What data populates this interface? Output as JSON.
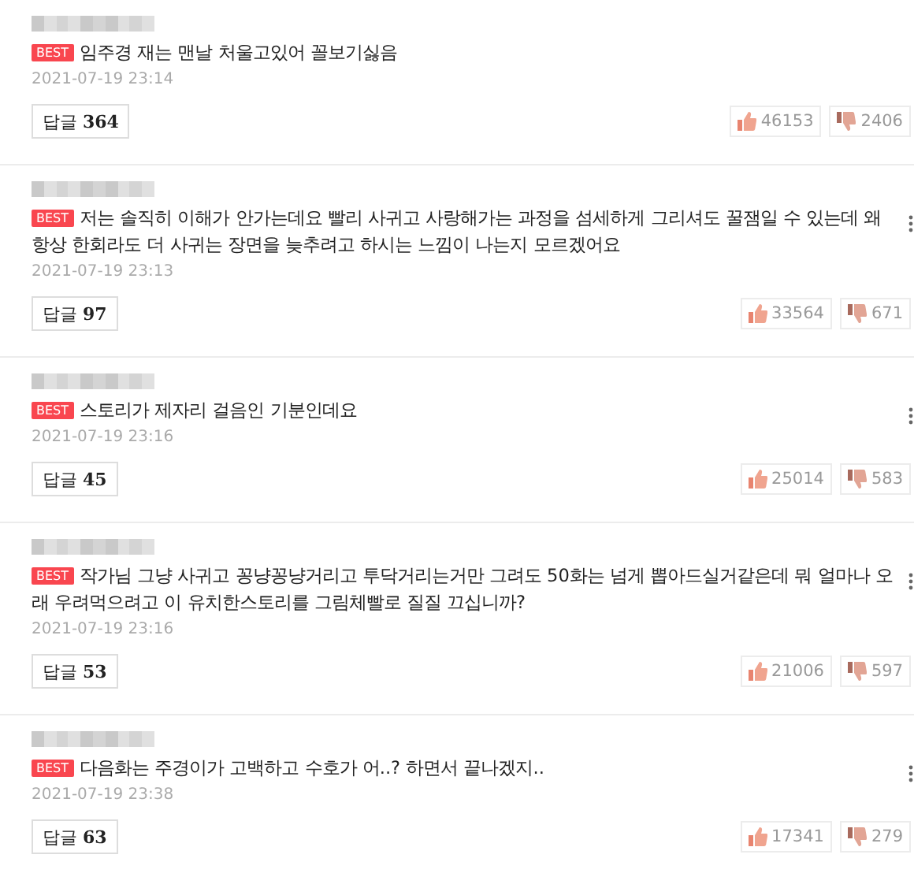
{
  "comments": [
    {
      "best": true,
      "badge": "BEST",
      "text": "임주경 재는 맨날 처울고있어 꼴보기싫음",
      "date": "2021-07-19 23:14",
      "reply_label": "답글",
      "reply_count": "364",
      "likes": "46153",
      "dislikes": "2406",
      "more_icon": false
    },
    {
      "best": true,
      "badge": "BEST",
      "text": "저는 솔직히 이해가 안가는데요 빨리 사귀고 사랑해가는 과정을 섬세하게 그리셔도 꿀잼일 수 있는데 왜 항상 한회라도 더 사귀는 장면을 늦추려고 하시는 느낌이 나는지 모르겠어요",
      "date": "2021-07-19 23:13",
      "reply_label": "답글",
      "reply_count": "97",
      "likes": "33564",
      "dislikes": "671",
      "more_icon": true
    },
    {
      "best": true,
      "badge": "BEST",
      "text": "스토리가 제자리 걸음인 기분인데요",
      "date": "2021-07-19 23:16",
      "reply_label": "답글",
      "reply_count": "45",
      "likes": "25014",
      "dislikes": "583",
      "more_icon": true
    },
    {
      "best": true,
      "badge": "BEST",
      "text": "작가님 그냥 사귀고 꽁냥꽁냥거리고 투닥거리는거만 그려도 50화는 넘게 뽑아드실거같은데 뭐 얼마나 오래 우려먹으려고 이 유치한스토리를 그림체빨로 질질 끄십니까?",
      "date": "2021-07-19 23:16",
      "reply_label": "답글",
      "reply_count": "53",
      "likes": "21006",
      "dislikes": "597",
      "more_icon": true
    },
    {
      "best": true,
      "badge": "BEST",
      "text": "다음화는 주경이가 고백하고 수호가 어..? 하면서 끝나겠지..",
      "date": "2021-07-19 23:38",
      "reply_label": "답글",
      "reply_count": "63",
      "likes": "17341",
      "dislikes": "279",
      "more_icon": true
    }
  ]
}
